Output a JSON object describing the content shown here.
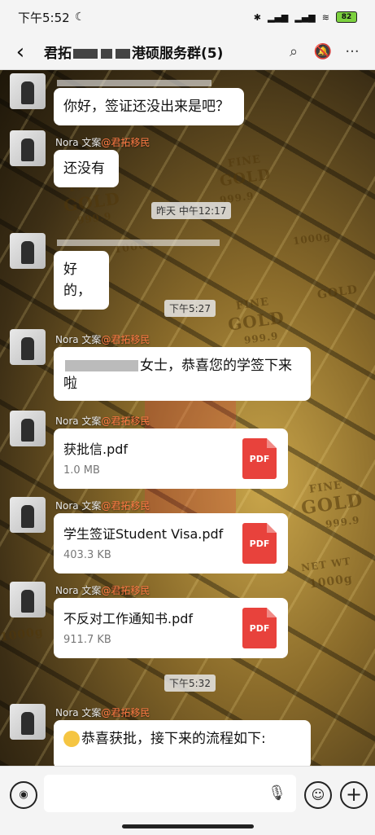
{
  "status": {
    "time": "下午5:52",
    "moon_icon": "moon-icon",
    "battery": "82"
  },
  "header": {
    "back": "‹",
    "title_start": "君拓",
    "title_end": "港硕服务群(5)",
    "search_icon": "search-icon",
    "mute_icon": "bell-off-icon",
    "more": "···"
  },
  "messages": [
    {
      "type": "text",
      "side": "left",
      "sender": "",
      "text": "你好，签证还没出来是吧？"
    },
    {
      "type": "text",
      "side": "left",
      "sender": "Nora 文案",
      "org": "@君拓移民",
      "text": "还没有"
    },
    {
      "type": "time",
      "text": "昨天 中午12:17"
    },
    {
      "type": "text",
      "side": "left",
      "sender": "",
      "text": "好的，"
    },
    {
      "type": "time",
      "text": "下午5:27"
    },
    {
      "type": "text",
      "side": "left",
      "sender": "Nora 文案",
      "org": "@君拓移民",
      "text_line1": "女士，恭喜您的学签下来",
      "text_line2": "啦"
    },
    {
      "type": "file",
      "sender": "Nora 文案",
      "org": "@君拓移民",
      "name": "获批信.pdf",
      "size": "1.0 MB",
      "badge": "PDF"
    },
    {
      "type": "file",
      "sender": "Nora 文案",
      "org": "@君拓移民",
      "name": "学生签证Student Visa.pdf",
      "size": "403.3 KB",
      "badge": "PDF"
    },
    {
      "type": "file",
      "sender": "Nora 文案",
      "org": "@君拓移民",
      "name": "不反对工作通知书.pdf",
      "size": "911.7 KB",
      "badge": "PDF"
    },
    {
      "type": "time",
      "text": "下午5:32"
    },
    {
      "type": "text",
      "side": "left",
      "sender": "Nora 文案",
      "org": "@君拓移民",
      "text": "恭喜获批，接下来的流程如下:"
    }
  ],
  "background": {
    "words": [
      "FINE",
      "GOLD",
      "999.9",
      "NET WT",
      "1000g"
    ]
  },
  "input": {
    "voice_icon": "voice-icon",
    "mic_icon": "mic-icon",
    "emoji_icon": "emoji-icon",
    "plus_icon": "plus-icon"
  }
}
